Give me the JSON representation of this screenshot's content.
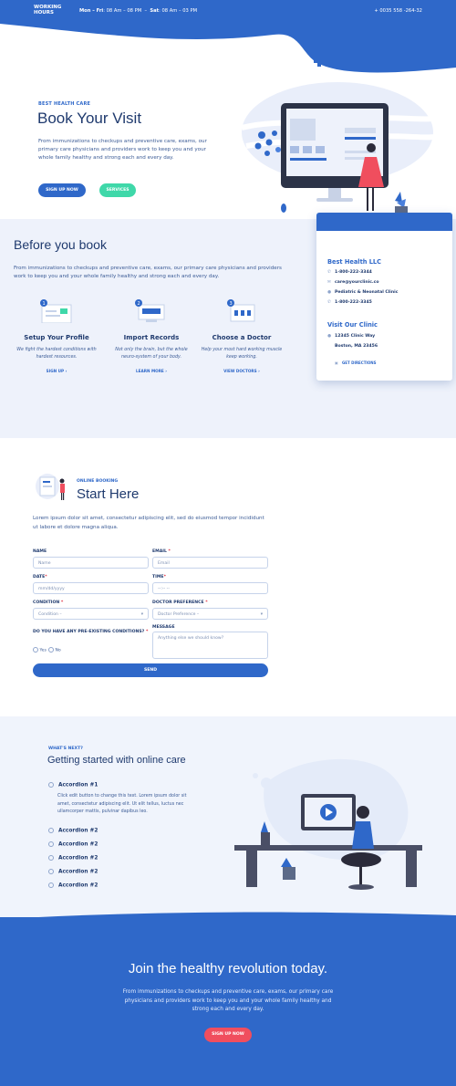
{
  "header": {
    "working_hours_label": "WORKING HOURS",
    "weekday_label": "Mon – Fri",
    "weekday_hours": ": 08 Am – 08 PM",
    "sat_label": "Sat",
    "sat_hours": ": 08 Am – 03 PM",
    "phone": "+ 0035 558 -264-32"
  },
  "hero": {
    "eyebrow": "BEST HEALTH CARE",
    "title": "Book Your Visit",
    "text": "From immunizations to checkups and  preventive care,  exams, our primary care physicians and providers work to keep you and your whole family healthy and strong each and every day.",
    "btn_signup": "SIGN UP NOW",
    "btn_services": "SERVICES"
  },
  "before": {
    "title": "Before you book",
    "text": "From immunizations to checkups and  preventive care,  exams, our primary care physicians and providers work to keep you and your whole family healthy and strong each and every day.",
    "steps": [
      {
        "num": "1",
        "title": "Setup Your Profile",
        "desc": "We fight the hardest conditions with hardest resources.",
        "link": "SIGN UP ›"
      },
      {
        "num": "2",
        "title": "Import Records",
        "desc": "Not only the brain, but the whole neuro-system of your body.",
        "link": "LEARN MORE ›"
      },
      {
        "num": "3",
        "title": "Choose a Doctor",
        "desc": "Help your most hard working muscle keep working.",
        "link": "VIEW DOCTORS ›"
      }
    ]
  },
  "contact": {
    "title": "Best Health LLC",
    "phone1": "1-800-222-3344",
    "email": "care@yourclinic.co",
    "clinic": "Pediatric & Neonatal Clinic",
    "phone2": "1-800-222-3345",
    "visit_title": "Visit Our Clinic",
    "address1": "12345 Clinic Way",
    "address2": "Boston, MA 23456",
    "directions": "GET DIRECTIONS"
  },
  "booking": {
    "eyebrow": "ONLINE BOOKING",
    "title": "Start Here",
    "text": "Lorem ipsum dolor sit amet, consectetur adipiscing elit, sed do eiusmod tempor incididunt ut labore et dolore magna aliqua.",
    "name_label": "NAME",
    "name_placeholder": "Name",
    "email_label": "EMAIL",
    "email_placeholder": "Email",
    "date_label": "DATE",
    "date_placeholder": "mm/dd/yyyy",
    "time_label": "TIME",
    "time_placeholder": "--:-- --",
    "condition_label": "CONDITION",
    "condition_value": "Condition –",
    "doctor_label": "DOCTOR PREFERENCE",
    "doctor_value": "Doctor Preference –",
    "preexisting_label": "DO YOU HAVE ANY PRE-EXISTING CONDITIONS?",
    "yes": "Yes",
    "no": "No",
    "message_label": "MESSAGE",
    "message_placeholder": "Anything else we should know?",
    "send": "SEND",
    "required_mark": "*"
  },
  "next": {
    "eyebrow": "WHAT'S NEXT?",
    "title": "Getting started with online care",
    "acc1_title": "Accordion #1",
    "acc1_body": "Click edit button to change this text. Lorem ipsum dolor sit amet, consectetur adipiscing elit. Ut elit tellus, luctus nec ullamcorper mattis, pulvinar dapibus leo.",
    "acc_items": [
      "Accordion #2",
      "Accordion #2",
      "Accordion #2",
      "Accordion #2",
      "Accordion #2"
    ]
  },
  "footer": {
    "title": "Join the healthy revolution today.",
    "text": "From immunizations to checkups and  preventive care,  exams, our primary care physicians and providers work to keep you and your whole family healthy and strong each and every day.",
    "button": "SIGN UP NOW"
  },
  "colors": {
    "primary": "#2f68c9",
    "accent_green": "#3fd8a9",
    "accent_red": "#f04e5e",
    "dark_text": "#1f3a6e"
  }
}
